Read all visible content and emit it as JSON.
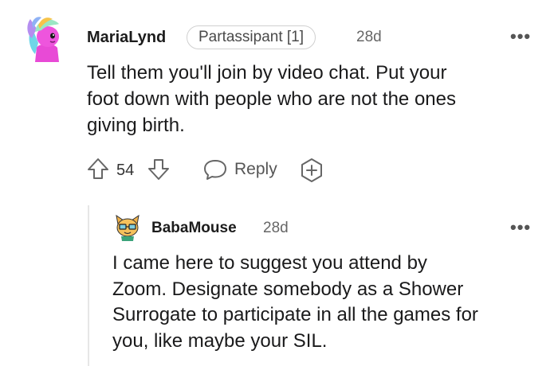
{
  "comment": {
    "username": "MariaLynd",
    "flair": "Partassipant [1]",
    "time": "28d",
    "more": "•••",
    "body_lines": [
      "Tell them you'll join by video chat. Put your",
      "foot down with people who are not the ones",
      "giving birth."
    ],
    "votes": "54",
    "reply_label": "Reply"
  },
  "reply": {
    "username": "BabaMouse",
    "time": "28d",
    "more": "•••",
    "body_lines": [
      "I came here to suggest you attend by",
      "Zoom. Designate somebody as a Shower",
      "Surrogate to participate in all the games for",
      "you, like maybe your SIL."
    ]
  },
  "icons": {
    "upvote": "arrow-up-icon",
    "downvote": "arrow-down-icon",
    "reply": "speech-bubble-icon",
    "award": "plus-award-icon"
  }
}
